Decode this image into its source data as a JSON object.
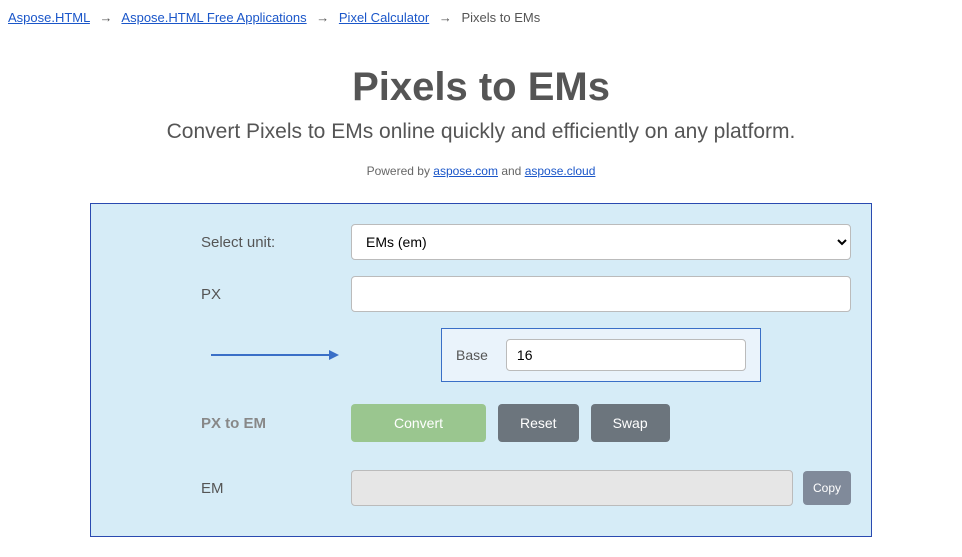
{
  "breadcrumb": {
    "items": [
      {
        "label": "Aspose.HTML",
        "link": true
      },
      {
        "label": "Aspose.HTML Free Applications",
        "link": true
      },
      {
        "label": "Pixel Calculator",
        "link": true
      },
      {
        "label": "Pixels to EMs",
        "link": false
      }
    ]
  },
  "header": {
    "title": "Pixels to EMs",
    "subtitle": "Convert Pixels to EMs online quickly and efficiently on any platform.",
    "powered_prefix": "Powered by ",
    "powered_link1": "aspose.com",
    "powered_and": " and ",
    "powered_link2": "aspose.cloud"
  },
  "form": {
    "select_label": "Select unit:",
    "select_value": "EMs (em)",
    "px_label": "PX",
    "px_value": "",
    "base_label": "Base",
    "base_value": "16",
    "direction_label": "PX to EM",
    "convert_btn": "Convert",
    "reset_btn": "Reset",
    "swap_btn": "Swap",
    "em_label": "EM",
    "em_value": "",
    "copy_btn": "Copy"
  }
}
